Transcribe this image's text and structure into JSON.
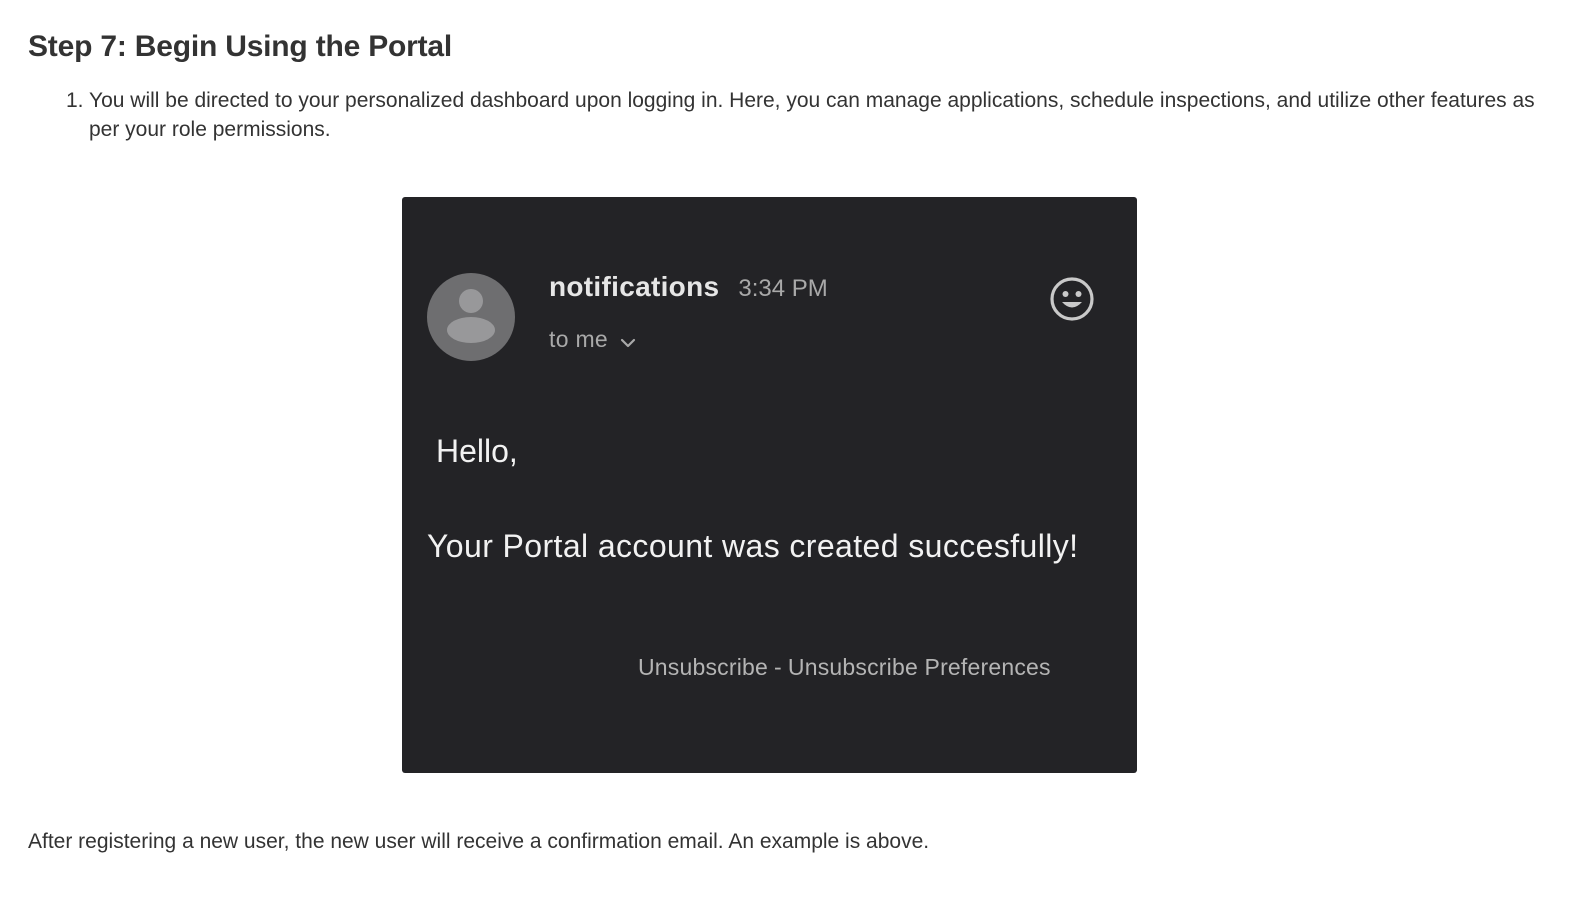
{
  "document": {
    "heading": "Step 7: Begin Using the Portal",
    "steps": [
      {
        "number": "1.",
        "text": "You will be directed to your personalized dashboard upon logging in. Here, you can manage applications, schedule inspections, and utilize other features as per your role permissions."
      }
    ],
    "caption": "After registering a new user, the new user will receive a confirmation email. An example is above."
  },
  "email": {
    "sender": "notifications",
    "time": "3:34 PM",
    "recipient": "to me",
    "greeting": "Hello,",
    "message": "Your Portal account was created succesfully!",
    "footer": {
      "unsubscribe": "Unsubscribe",
      "separator": "-",
      "preferences": "Unsubscribe Preferences"
    },
    "icons": {
      "avatar": "person-avatar-icon",
      "recipient_toggle": "chevron-down-icon",
      "reaction": "smiley-face-icon"
    },
    "colors": {
      "card_background": "#232326",
      "text_primary": "#f2f2f2",
      "text_secondary": "#a9a9a9"
    }
  }
}
